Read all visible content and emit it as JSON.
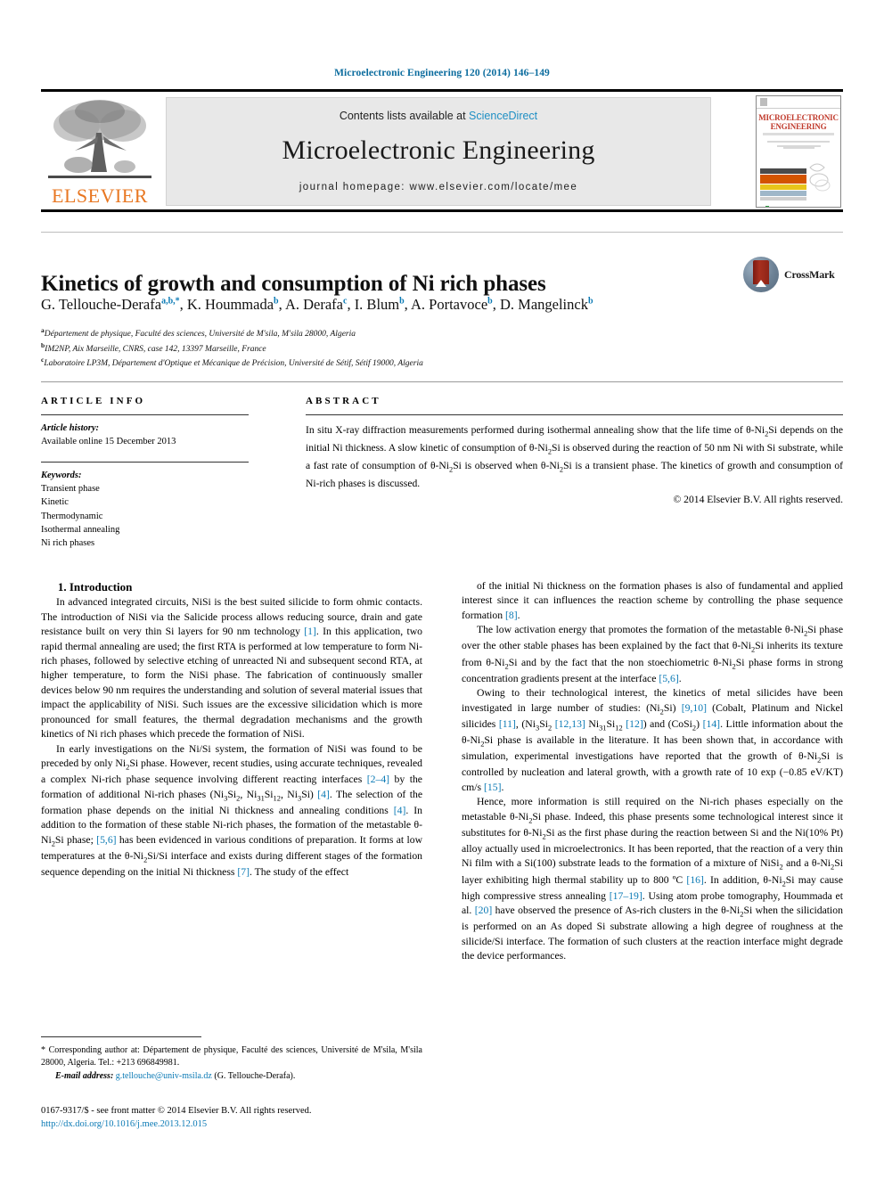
{
  "running_head": "Microelectronic Engineering 120 (2014) 146–149",
  "masthead": {
    "contents_prefix": "Contents lists available at ",
    "sciencedirect": "ScienceDirect",
    "journal_title": "Microelectronic Engineering",
    "homepage": "journal homepage: www.elsevier.com/locate/mee",
    "publisher_wordmark": "ELSEVIER",
    "cover_title_line1": "MICROELECTRONIC",
    "cover_title_line2": "ENGINEERING",
    "accent_blue": "#1f8fc4",
    "elsevier_orange": "#E87722"
  },
  "article": {
    "title": "Kinetics of growth and consumption of Ni rich phases",
    "crossmark_label": "CrossMark",
    "authors": [
      {
        "name": "G. Tellouche-Derafa",
        "marks": "a,b,*"
      },
      {
        "name": "K. Hoummada",
        "marks": "b"
      },
      {
        "name": "A. Derafa",
        "marks": "c"
      },
      {
        "name": "I. Blum",
        "marks": "b"
      },
      {
        "name": "A. Portavoce",
        "marks": "b"
      },
      {
        "name": "D. Mangelinck",
        "marks": "b"
      }
    ],
    "affiliations": [
      {
        "mark": "a",
        "text": "Département de physique, Faculté des sciences, Université de M'sila, M'sila 28000, Algeria"
      },
      {
        "mark": "b",
        "text": "IM2NP, Aix Marseille, CNRS, case 142, 13397 Marseille, France"
      },
      {
        "mark": "c",
        "text": "Laboratoire LP3M, Département d'Optique et Mécanique de Précision, Université de Sétif, Sétif 19000, Algeria"
      }
    ]
  },
  "article_info": {
    "heading": "ARTICLE INFO",
    "history_label": "Article history:",
    "history_value": "Available online 15 December 2013",
    "keywords_label": "Keywords:",
    "keywords": [
      "Transient phase",
      "Kinetic",
      "Thermodynamic",
      "Isothermal annealing",
      "Ni rich phases"
    ]
  },
  "abstract": {
    "heading": "ABSTRACT",
    "text": "In situ X-ray diffraction measurements performed during isothermal annealing show that the life time of θ-Ni2Si depends on the initial Ni thickness. A slow kinetic of consumption of θ-Ni2Si is observed during the reaction of 50 nm Ni with Si substrate, while a fast rate of consumption of θ-Ni2Si is observed when θ-Ni2Si is a transient phase. The kinetics of growth and consumption of Ni-rich phases is discussed.",
    "copyright": "© 2014 Elsevier B.V. All rights reserved."
  },
  "body": {
    "section1_heading": "1. Introduction",
    "left_paragraphs": [
      "In advanced integrated circuits, NiSi is the best suited silicide to form ohmic contacts. The introduction of NiSi via the Salicide process allows reducing source, drain and gate resistance built on very thin Si layers for 90 nm technology [1]. In this application, two rapid thermal annealing are used; the first RTA is performed at low temperature to form Ni-rich phases, followed by selective etching of unreacted Ni and subsequent second RTA, at higher temperature, to form the NiSi phase. The fabrication of continuously smaller devices below 90 nm requires the understanding and solution of several material issues that impact the applicability of NiSi. Such issues are the excessive silicidation which is more pronounced for small features, the thermal degradation mechanisms and the growth kinetics of Ni rich phases which precede the formation of NiSi.",
      "In early investigations on the Ni/Si system, the formation of NiSi was found to be preceded by only Ni2Si phase. However, recent studies, using accurate techniques, revealed a complex Ni-rich phase sequence involving different reacting interfaces [2–4] by the formation of additional Ni-rich phases (Ni3Si2, Ni31Si12, Ni3Si) [4]. The selection of the formation phase depends on the initial Ni thickness and annealing conditions [4]. In addition to the formation of these stable Ni-rich phases, the formation of the metastable θ-Ni2Si phase; [5,6] has been evidenced in various conditions of preparation. It forms at low temperatures at the θ-Ni2Si/Si interface and exists during different stages of the formation sequence depending on the initial Ni thickness [7]. The study of the effect"
    ],
    "right_paragraphs": [
      "of the initial Ni thickness on the formation phases is also of fundamental and applied interest since it can influences the reaction scheme by controlling the phase sequence formation [8].",
      "The low activation energy that promotes the formation of the metastable θ-Ni2Si phase over the other stable phases has been explained by the fact that θ-Ni2Si inherits its texture from θ-Ni2Si and by the fact that the non stoechiometric θ-Ni2Si phase forms in strong concentration gradients present at the interface [5,6].",
      "Owing to their technological interest, the kinetics of metal silicides have been investigated in large number of studies: (Ni2Si) [9,10] (Cobalt, Platinum and Nickel silicides [11], (Ni3Si2 [12,13] Ni31Si12 [12]) and (CoSi2) [14]. Little information about the θ-Ni2Si phase is available in the literature. It has been shown that, in accordance with simulation, experimental investigations have reported that the growth of θ-Ni2Si is controlled by nucleation and lateral growth, with a growth rate of 10 exp (−0.85 eV/KT) cm/s [15].",
      "Hence, more information is still required on the Ni-rich phases especially on the metastable θ-Ni2Si phase. Indeed, this phase presents some technological interest since it substitutes for θ-Ni2Si as the first phase during the reaction between Si and the Ni(10% Pt) alloy actually used in microelectronics. It has been reported, that the reaction of a very thin Ni film with a Si(100) substrate leads to the formation of a mixture of NiSi2 and a θ-Ni2Si layer exhibiting high thermal stability up to 800 ºC [16]. In addition, θ-Ni2Si may cause high compressive stress annealing [17–19]. Using atom probe tomography, Hoummada et al. [20] have observed the presence of As-rich clusters in the θ-Ni2Si when the silicidation is performed on an As doped Si substrate allowing a high degree of roughness at the silicide/Si interface. The formation of such clusters at the reaction interface might degrade the device performances."
    ]
  },
  "footnote": {
    "corresponding": "* Corresponding author at: Département de physique, Faculté des sciences, Université de M'sila, M'sila 28000, Algeria. Tel.: +213 696849981.",
    "email_label": "E-mail address:",
    "email": "g.tellouche@univ-msila.dz",
    "email_owner": "(G. Tellouche-Derafa)."
  },
  "issn_block": {
    "line1": "0167-9317/$ - see front matter © 2014 Elsevier B.V. All rights reserved.",
    "doi": "http://dx.doi.org/10.1016/j.mee.2013.12.015"
  }
}
